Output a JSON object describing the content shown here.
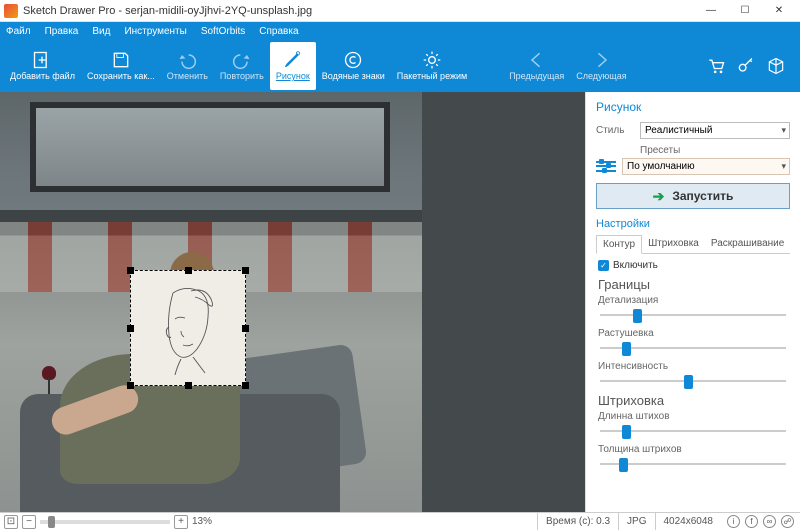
{
  "title": "Sketch Drawer Pro - serjan-midili-oyJjhvi-2YQ-unsplash.jpg",
  "menu": {
    "file": "Файл",
    "edit": "Правка",
    "view": "Вид",
    "tools": "Инструменты",
    "softorbits": "SoftOrbits",
    "help": "Справка"
  },
  "ribbon": {
    "add": "Добавить файл",
    "save_as": "Сохранить как...",
    "undo": "Отменить",
    "redo": "Повторить",
    "drawing": "Рисунок",
    "watermark": "Водяные знаки",
    "batch": "Пакетный режим",
    "prev": "Предыдущая",
    "next": "Следующая"
  },
  "sidebar": {
    "title": "Рисунок",
    "style_label": "Стиль",
    "style_value": "Реалистичный",
    "presets_label": "Пресеты",
    "preset_value": "По умолчанию",
    "run": "Запустить",
    "settings": "Настройки",
    "tabs": {
      "contour": "Контур",
      "shading": "Штриховка",
      "coloring": "Раскрашивание"
    },
    "enable": "Включить",
    "borders": "Границы",
    "detail": "Детализация",
    "feather": "Растушевка",
    "intensity": "Интенсивность",
    "hatching": "Штриховка",
    "stroke_len": "Длинна штихов",
    "stroke_thick": "Толщина штрихов",
    "sliders": {
      "detail": 18,
      "feather": 12,
      "intensity": 45,
      "stroke_len": 12,
      "stroke_thick": 10
    }
  },
  "status": {
    "zoom": "13%",
    "time_label": "Время (с):",
    "time_value": "0.3",
    "format": "JPG",
    "dims": "4024x6048"
  }
}
